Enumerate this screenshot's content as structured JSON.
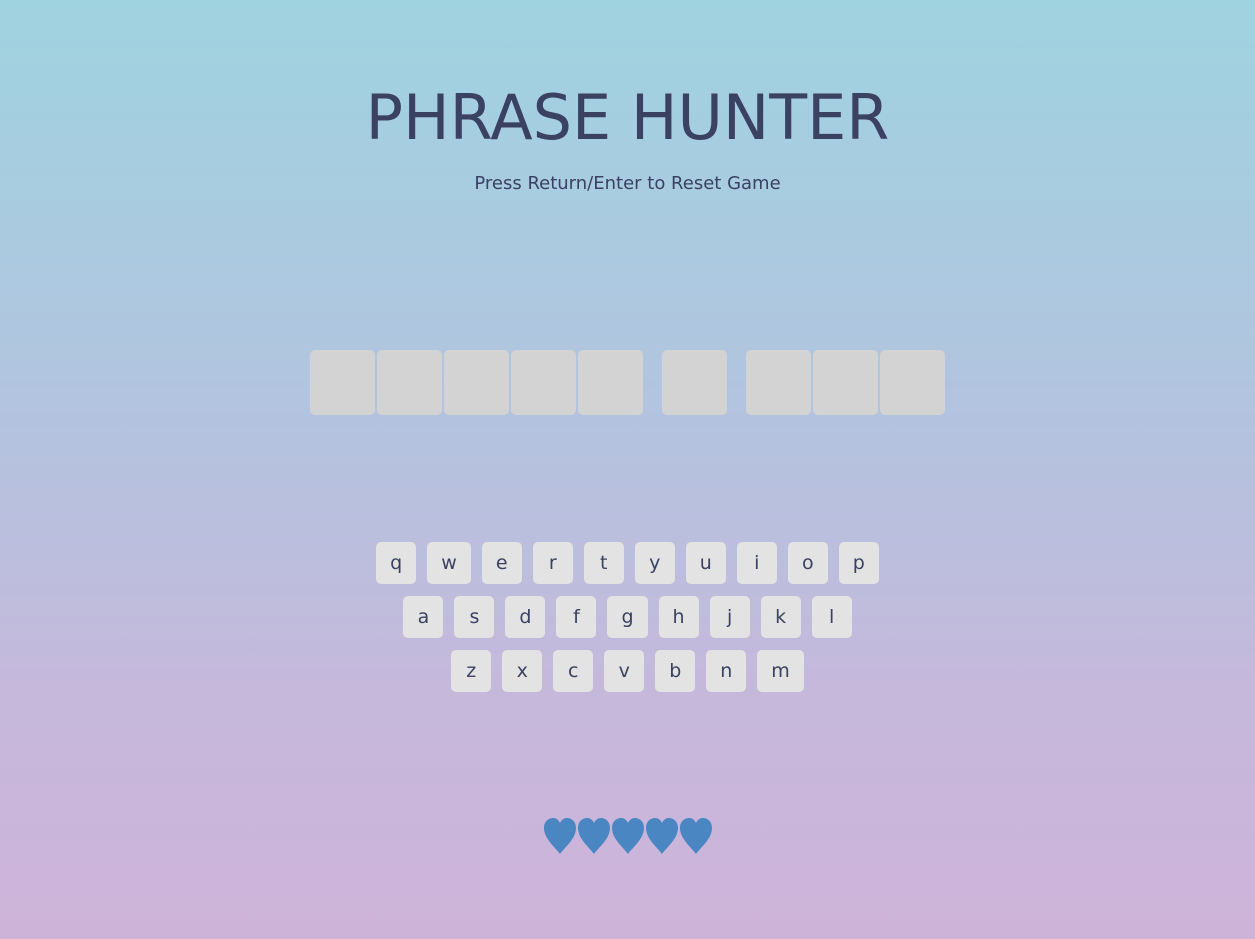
{
  "header": {
    "title": "PHRASE HUNTER",
    "subtitle": "Press Return/Enter to Reset Game"
  },
  "phrase": {
    "words": [
      {
        "letters": 5
      },
      {
        "letters": 1
      },
      {
        "letters": 3
      }
    ]
  },
  "keyboard": {
    "rows": [
      [
        "q",
        "w",
        "e",
        "r",
        "t",
        "y",
        "u",
        "i",
        "o",
        "p"
      ],
      [
        "a",
        "s",
        "d",
        "f",
        "g",
        "h",
        "j",
        "k",
        "l"
      ],
      [
        "z",
        "x",
        "c",
        "v",
        "b",
        "n",
        "m"
      ]
    ]
  },
  "lives": {
    "count": 5,
    "icon": "heart-icon",
    "color": "#4a86c2"
  }
}
